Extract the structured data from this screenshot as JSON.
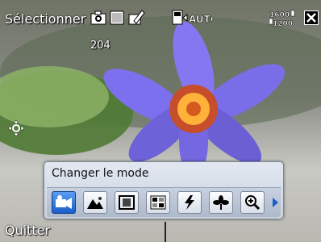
{
  "status_bar": {
    "title": "Sélectionner",
    "counter": "204",
    "flash": "AUTO",
    "resolution_top": "1600",
    "resolution_bottom": "1200",
    "icons": [
      "camera-icon",
      "white-balance-icon",
      "edit-icon",
      "flash-auto-icon",
      "resolution-icon",
      "close-icon"
    ]
  },
  "mode_menu": {
    "title": "Changer le mode",
    "buttons": [
      {
        "icon": "video-camera-icon",
        "selected": true
      },
      {
        "icon": "landscape-icon",
        "selected": false
      },
      {
        "icon": "frame-icon",
        "selected": false
      },
      {
        "icon": "grid-icon",
        "selected": false
      },
      {
        "icon": "sport-icon",
        "selected": false
      },
      {
        "icon": "macro-flower-icon",
        "selected": false
      },
      {
        "icon": "zoom-icon",
        "selected": false
      }
    ]
  },
  "softkey": {
    "left": "Quitter"
  },
  "colors": {
    "accent": "#1a5ec9",
    "panel": "#d6dde8",
    "flower": "#7b6ff0"
  }
}
